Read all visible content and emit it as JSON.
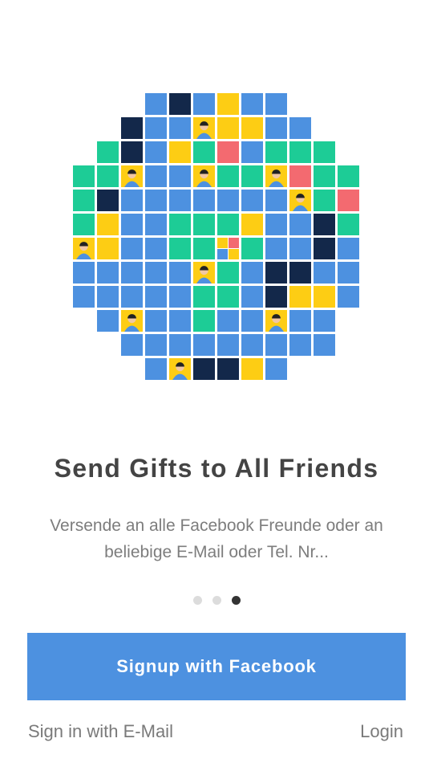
{
  "colors": {
    "blue": "#4d91e0",
    "navy": "#13284a",
    "yellow": "#fdcd14",
    "green": "#1dcc96",
    "red": "#f36a70",
    "avatar_skin": "#f1c8a4",
    "avatar_hair": "#222222"
  },
  "mosaic_grid": [
    "...BNBYBB....",
    "..NBBaYYBB...",
    ".GNBYGRBGGG..",
    "GGaBBaGGaRGG.",
    "GNBBBBBBBaGR.",
    "GYBBGGGYBBNG.",
    "aYBBGGcGBBNB.",
    "BBBBBaGBNNBB.",
    "BBBBBGGBNYYB.",
    ".BaBBGBBaBB..",
    "..BBBBBBBBB..",
    "...BaNNYB...."
  ],
  "mosaic_legend": {
    "B": "blue",
    "N": "navy",
    "Y": "yellow",
    "G": "green",
    "R": "red",
    "a": "avatar",
    "c": "gift-cluster"
  },
  "onboarding": {
    "title": "Send Gifts to All Friends",
    "subtitle": "Versende an alle Facebook Freunde oder an beliebige E-Mail oder Tel. Nr...",
    "page_count": 3,
    "active_page": 3
  },
  "actions": {
    "facebook_signup": "Signup with Facebook",
    "email_signin": "Sign in with E-Mail",
    "login": "Login"
  }
}
